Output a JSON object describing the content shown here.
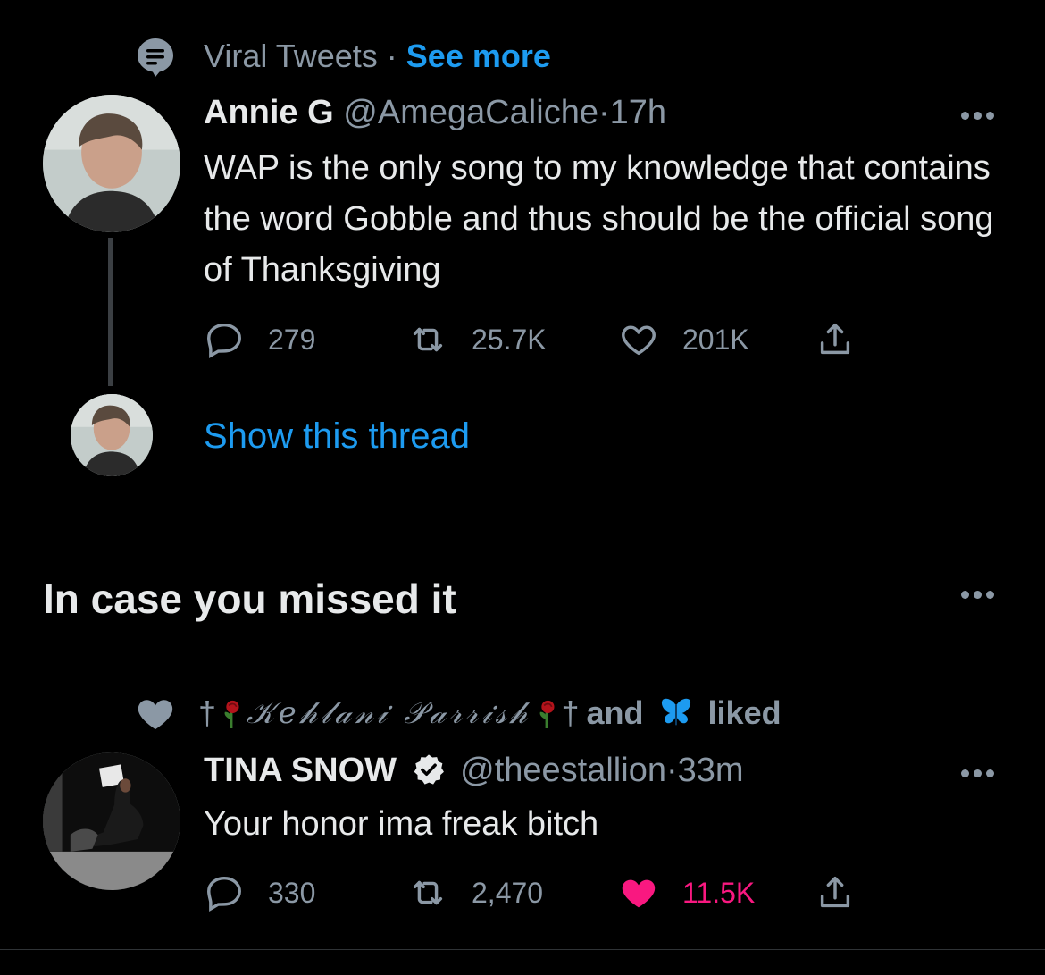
{
  "colors": {
    "background": "#000000",
    "text": "#e7e9ea",
    "muted": "#8b98a5",
    "link": "#1d9bf0",
    "like": "#f91880",
    "divider": "#2f3336"
  },
  "tweet1": {
    "context": {
      "icon": "topic-icon",
      "topic": "Viral Tweets",
      "separator": "·",
      "see_more": "See more"
    },
    "author_name": "Annie G",
    "handle": "@AmegaCaliche",
    "time_sep": "·",
    "time": "17h",
    "text": "WAP is the only song to my knowledge that contains the word Gobble and thus should be the official song of Thanksgiving",
    "replies": "279",
    "retweets": "25.7K",
    "likes": "201K",
    "liked": false,
    "show_thread": "Show this thread"
  },
  "section": {
    "title": "In case you missed it"
  },
  "tweet2": {
    "context": {
      "icon": "heart-icon",
      "liker_prefix": "†",
      "liker_name": "𝒦𝑒𝒽𝓁𝒶𝓃𝒾 𝒫𝒶𝓇𝓇𝒾𝓈𝒽",
      "liker_suffix": "†",
      "and_text": "and",
      "second_liker_icon": "butterfly-icon",
      "liked_text": "liked"
    },
    "author_name": "TINA SNOW",
    "verified": true,
    "handle": "@theestallion",
    "time_sep": "·",
    "time": "33m",
    "text": "Your honor ima freak bitch",
    "replies": "330",
    "retweets": "2,470",
    "likes": "11.5K",
    "liked": true
  }
}
